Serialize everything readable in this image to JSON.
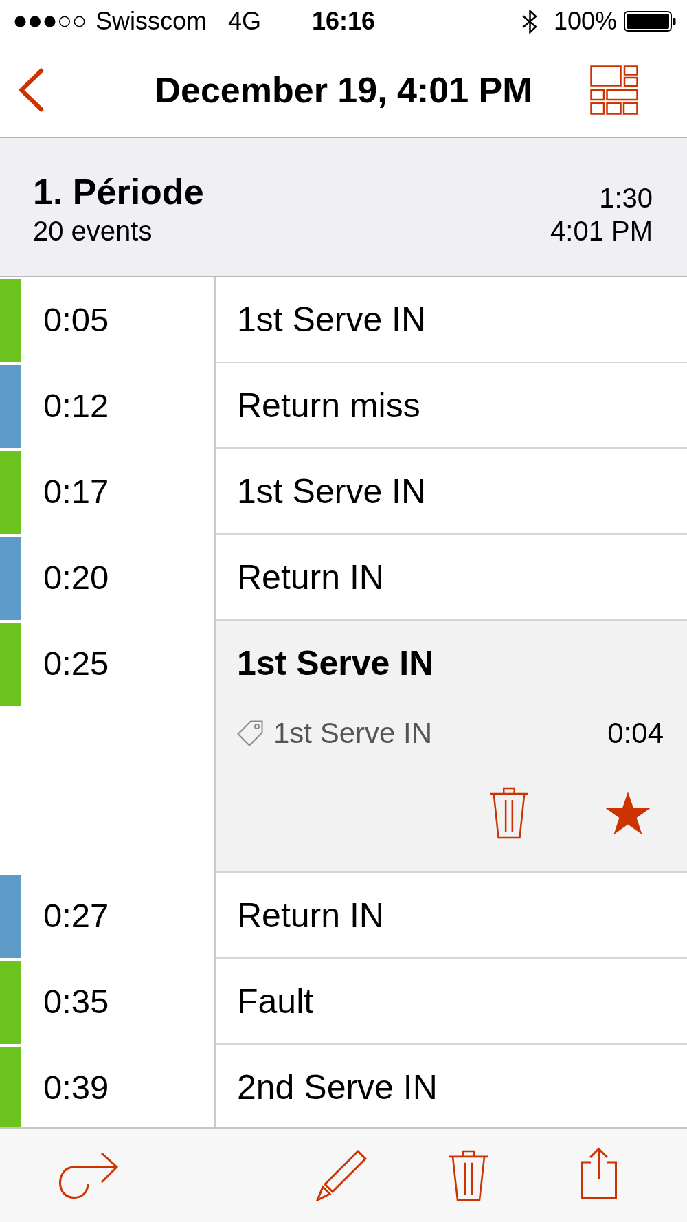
{
  "status_bar": {
    "carrier": "Swisscom",
    "network": "4G",
    "time": "16:16",
    "battery": "100%"
  },
  "nav": {
    "title": "December 19, 4:01 PM"
  },
  "period": {
    "title": "1. Période",
    "count": "20 events",
    "duration": "1:30",
    "time": "4:01 PM"
  },
  "events": [
    {
      "time": "0:05",
      "label": "1st Serve IN",
      "color": "#6cc31e",
      "expanded": false
    },
    {
      "time": "0:12",
      "label": "Return miss",
      "color": "#5e9bc8",
      "expanded": false
    },
    {
      "time": "0:17",
      "label": "1st Serve IN",
      "color": "#6cc31e",
      "expanded": false
    },
    {
      "time": "0:20",
      "label": "Return IN",
      "color": "#5e9bc8",
      "expanded": false
    },
    {
      "time": "0:25",
      "label": "1st Serve IN",
      "color": "#6cc31e",
      "expanded": true,
      "tag": "1st Serve IN",
      "duration": "0:04",
      "starred": true
    },
    {
      "time": "0:27",
      "label": "Return IN",
      "color": "#5e9bc8",
      "expanded": false
    },
    {
      "time": "0:35",
      "label": "Fault",
      "color": "#6cc31e",
      "expanded": false
    },
    {
      "time": "0:39",
      "label": "2nd Serve IN",
      "color": "#6cc31e",
      "expanded": false
    }
  ]
}
